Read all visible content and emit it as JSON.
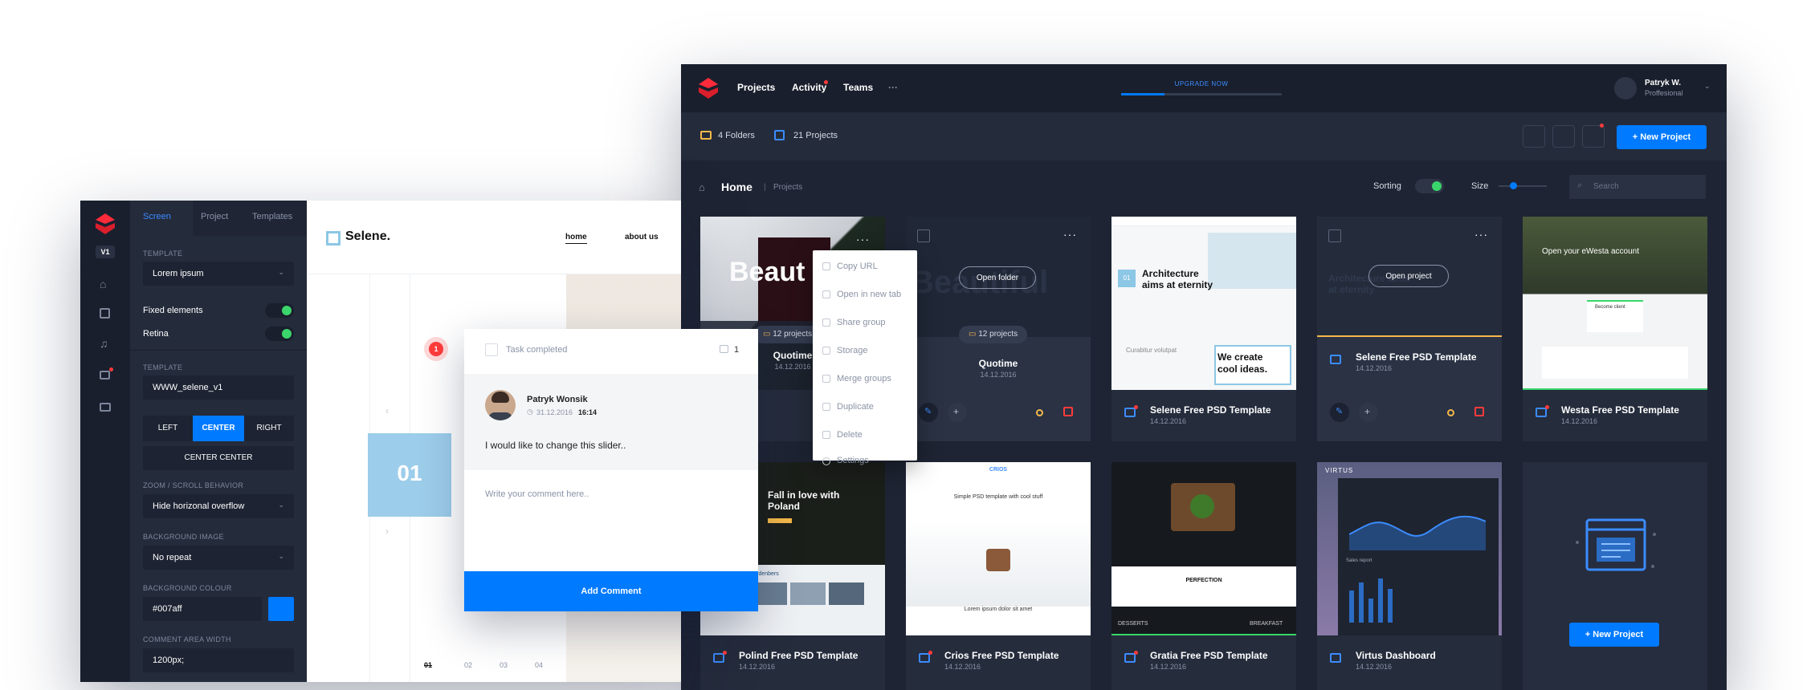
{
  "dashboard": {
    "nav": [
      "Projects",
      "Activity",
      "Teams",
      "···"
    ],
    "upgrade": "UPGRADE NOW",
    "user": {
      "name": "Patryk W.",
      "role": "Proffesional"
    },
    "folders": "4 Folders",
    "projects": "21 Projects",
    "new_project": "New Project",
    "breadcrumb": {
      "home": "Home",
      "current": "Projects"
    },
    "sorting": "Sorting",
    "size": "Size",
    "search_placeholder": "Search",
    "context_menu": [
      "Copy URL",
      "Open in new tab",
      "Share group",
      "Storage",
      "Merge groups",
      "Duplicate",
      "Delete",
      "Settings"
    ],
    "cards": [
      {
        "title": "Quotime",
        "date": "14.12.2016",
        "badge": "12 projects",
        "overlay": "Beaut"
      },
      {
        "title": "Quotime",
        "date": "14.12.2016",
        "badge": "12 projects",
        "overlay_button": "Open folder",
        "bg_text": "Beautiful"
      },
      {
        "title": "Selene Free PSD Template",
        "date": "14.12.2016",
        "thumb_heading": "Architecture aims at eternity",
        "thumb_tag": "01",
        "thumb_sub": "Curabitur volutpat",
        "thumb_quote": "We create cool ideas."
      },
      {
        "title": "Selene Free PSD Template",
        "date": "14.12.2016",
        "overlay_button": "Open project",
        "bg_text": "Architecture aims at eternity"
      },
      {
        "title": "Westa Free PSD Template",
        "date": "14.12.2016",
        "thumb_heading": "Open your eWesta account",
        "thumb_sub": "Become client"
      },
      {
        "title": "Polind Free PSD Template",
        "date": "14.12.2016",
        "thumb_heading": "Fall in love with Poland",
        "thumb_sub": "Saddenbers"
      },
      {
        "title": "Crios Free PSD Template",
        "date": "14.12.2016",
        "thumb_heading": "Simple PSD template with cool stuff",
        "thumb_logo": "CRIOS",
        "thumb_sub": "Lorem ipsum dolor sit amet"
      },
      {
        "title": "Gratia Free PSD Template",
        "date": "14.12.2016",
        "thumb_heading": "PERFECTION",
        "thumb_sub": "DESSERTS",
        "thumb_sub2": "BREAKFAST"
      },
      {
        "title": "Virtus Dashboard",
        "date": "14.12.2016",
        "thumb_logo": "VIRTUS",
        "thumb_sub": "Sales report"
      }
    ],
    "empty_card_button": "New Project"
  },
  "editor": {
    "version": "V1",
    "tabs": [
      "Screen",
      "Project",
      "Templates"
    ],
    "template_label": "TEMPLATE",
    "template_value": "Lorem ipsum",
    "fixed_elements": "Fixed elements",
    "retina": "Retina",
    "template2_label": "TEMPLATE",
    "template2_value": "WWW_selene_v1",
    "align": [
      "LEFT",
      "CENTER",
      "RIGHT"
    ],
    "center_center": "CENTER CENTER",
    "zoom_label": "ZOOM / SCROLL BEHAVIOR",
    "zoom_value": "Hide horizonal overflow",
    "bg_image_label": "BACKGROUND IMAGE",
    "bg_image_value": "No repeat",
    "bg_colour_label": "BACKGROUND COLOUR",
    "bg_colour_value": "#007aff",
    "comment_width_label": "COMMENT AREA WIDTH",
    "comment_width_value": "1200px;",
    "site": {
      "logo": "Selene.",
      "nav": [
        "home",
        "about us"
      ],
      "slide": "01",
      "pager": [
        "01",
        "02",
        "03",
        "04"
      ]
    }
  },
  "comment": {
    "marker": "1",
    "task": "Task completed",
    "count": "1",
    "author": "Patryk Wonsik",
    "date": "31.12.2016",
    "time": "16:14",
    "text": "I would like to change this slider..",
    "placeholder": "Write your comment here..",
    "button": "Add Comment"
  },
  "colors": {
    "accent": "#007aff",
    "green": "#3ad66b",
    "dark": "#1e2433",
    "panel": "#242b3b"
  }
}
